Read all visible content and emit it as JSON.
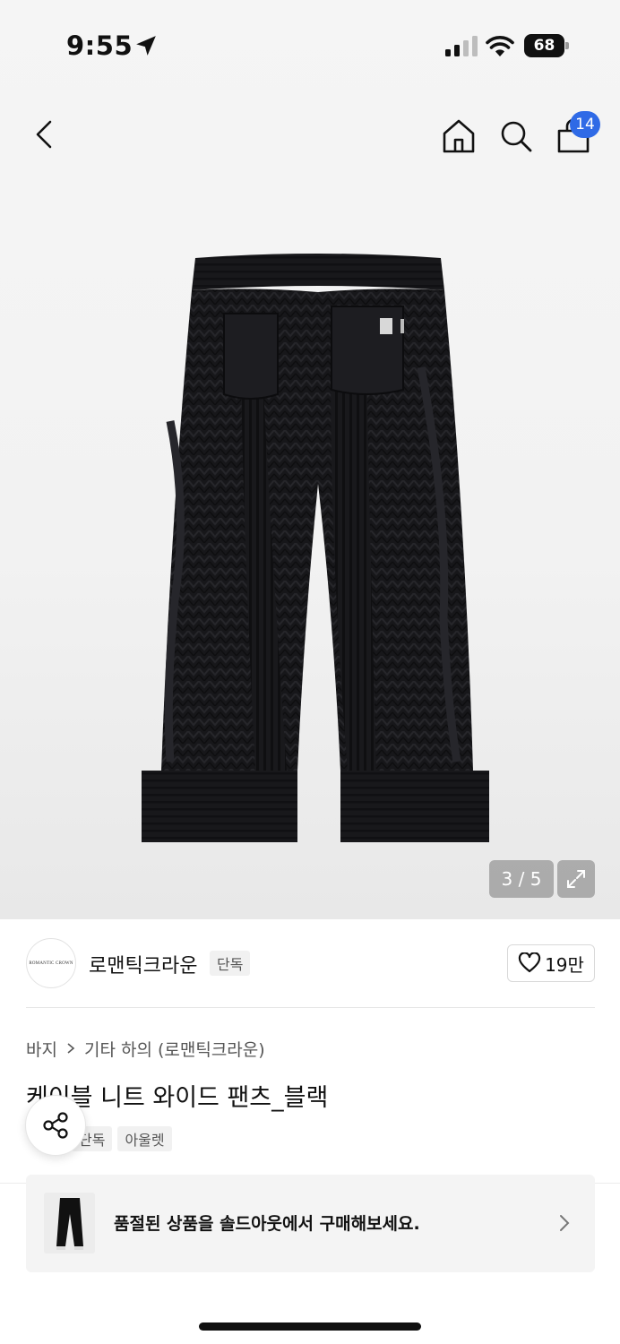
{
  "status_bar": {
    "time": "9:55",
    "battery": "68"
  },
  "nav": {
    "cart_count": "14"
  },
  "gallery": {
    "counter": "3 / 5"
  },
  "brand": {
    "name": "로맨틱크라운",
    "tag": "단독",
    "logo_text": "ROMANTIC CROWN",
    "likes": "19만"
  },
  "breadcrumb": {
    "level1": "바지",
    "level2": "기타 하의 (로맨틱크라운)"
  },
  "product": {
    "title": "케이블 니트 와이드 팬츠_블랙",
    "tags": [
      "단독",
      "아울렛"
    ]
  },
  "soldout_banner": {
    "text": "품절된 상품을 솔드아웃에서 구매해보세요."
  },
  "icons": {
    "back": "chevron-left-icon",
    "home": "home-icon",
    "search": "search-icon",
    "bag": "shopping-bag-icon",
    "expand": "expand-icon",
    "like": "heart-icon",
    "share": "share-icon"
  }
}
